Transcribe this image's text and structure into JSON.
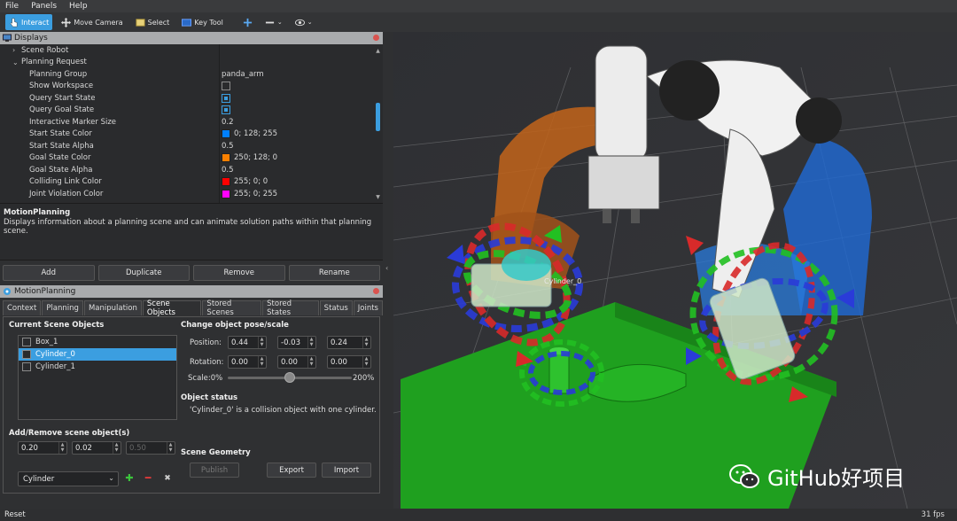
{
  "menu": [
    "File",
    "Panels",
    "Help"
  ],
  "toolbar": {
    "interact": "Interact",
    "move_camera": "Move Camera",
    "select": "Select",
    "key_tool": "Key Tool"
  },
  "displays": {
    "title": "Displays",
    "rows": [
      {
        "key": "Scene Robot",
        "value": ""
      },
      {
        "key": "Planning Request",
        "value": ""
      },
      {
        "key": "Planning Group",
        "value": "panda_arm"
      },
      {
        "key": "Show Workspace",
        "value": ""
      },
      {
        "key": "Query Start State",
        "value": ""
      },
      {
        "key": "Query Goal State",
        "value": ""
      },
      {
        "key": "Interactive Marker Size",
        "value": "0.2"
      },
      {
        "key": "Start State Color",
        "value": "0; 128; 255"
      },
      {
        "key": "Start State Alpha",
        "value": "0.5"
      },
      {
        "key": "Goal State Color",
        "value": "250; 128; 0"
      },
      {
        "key": "Goal State Alpha",
        "value": "0.5"
      },
      {
        "key": "Colliding Link Color",
        "value": "255; 0; 0"
      },
      {
        "key": "Joint Violation Color",
        "value": "255; 0; 255"
      }
    ],
    "colors": {
      "start": "#0080ff",
      "goal": "#fa8000",
      "colliding": "#ff0000",
      "violation": "#ff00ff"
    }
  },
  "description": {
    "title": "MotionPlanning",
    "text": "Displays information about a planning scene and can animate solution paths within that planning scene."
  },
  "buttons": {
    "add": "Add",
    "duplicate": "Duplicate",
    "remove": "Remove",
    "rename": "Rename"
  },
  "motion_planning": {
    "title": "MotionPlanning",
    "tabs": [
      "Context",
      "Planning",
      "Manipulation",
      "Scene Objects",
      "Stored Scenes",
      "Stored States",
      "Status",
      "Joints"
    ]
  },
  "scene_objects": {
    "current_label": "Current Scene Objects",
    "objects": [
      "Box_1",
      "Cylinder_0",
      "Cylinder_1"
    ],
    "change_pose_label": "Change object pose/scale",
    "position_label": "Position:",
    "position": [
      "0.44",
      "-0.03",
      "0.24"
    ],
    "rotation_label": "Rotation:",
    "rotation": [
      "0.00",
      "0.00",
      "0.00"
    ],
    "scale_label": "Scale:",
    "scale_min": "0%",
    "scale_max": "200%",
    "scale_value": 0.5,
    "status_label": "Object status",
    "status_text": "'Cylinder_0' is a collision object with one cylinder.",
    "add_remove_label": "Add/Remove scene object(s)",
    "dims": [
      "0.20",
      "0.02",
      "0.50"
    ],
    "shape": "Cylinder",
    "geometry_label": "Scene Geometry",
    "publish": "Publish",
    "export": "Export",
    "import": "Import"
  },
  "viewport": {
    "object_label": "Cylinder_0"
  },
  "status": {
    "reset": "Reset",
    "fps": "31 fps"
  },
  "watermark": "GitHub好项目"
}
